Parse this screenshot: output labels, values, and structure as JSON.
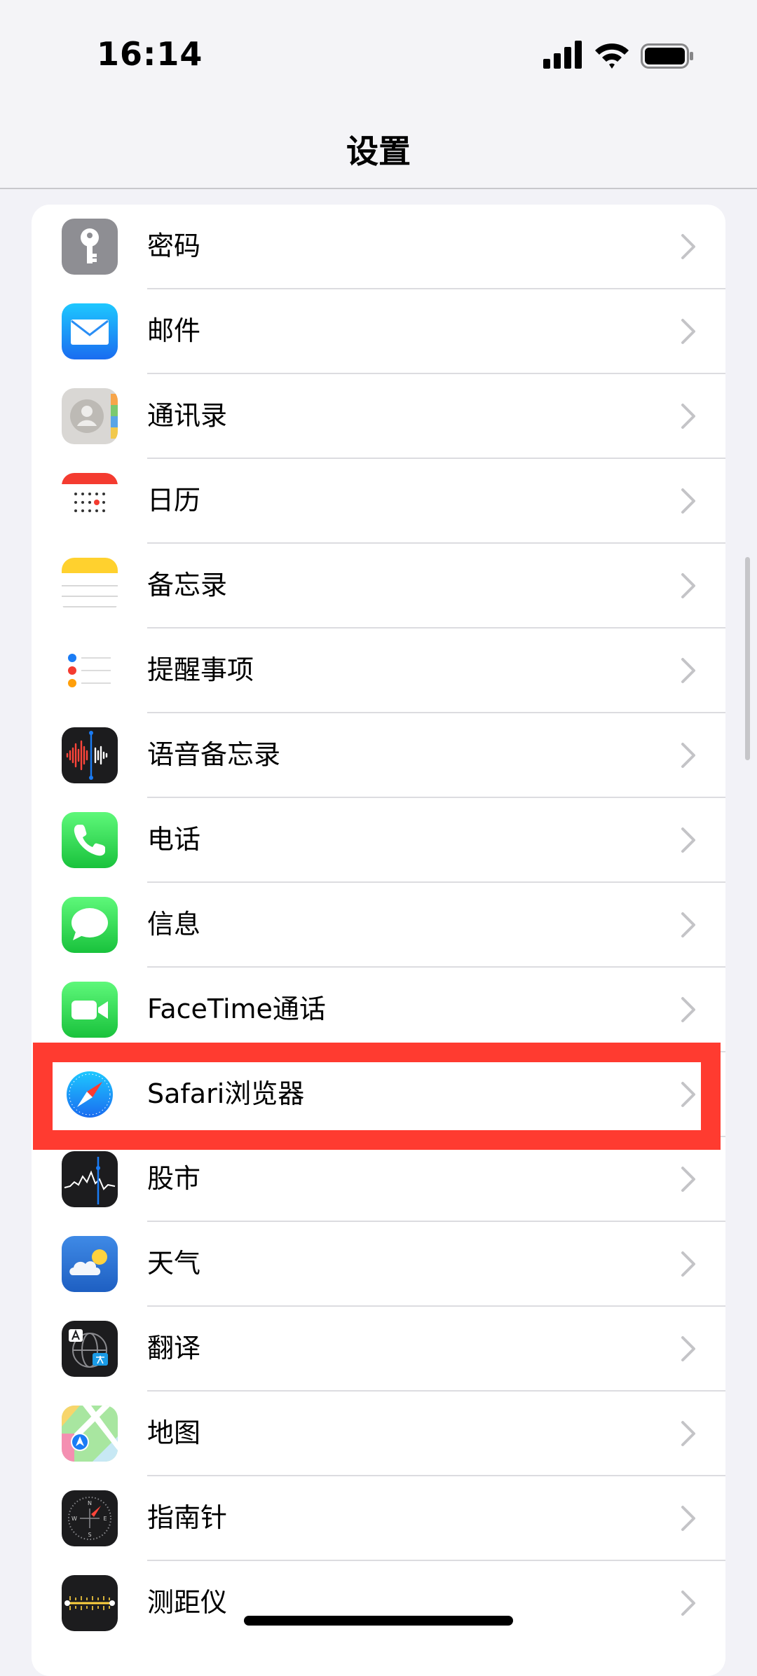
{
  "status_bar": {
    "time": "16:14"
  },
  "header": {
    "title": "设置"
  },
  "settings_items": [
    {
      "label": "密码",
      "icon": "key-icon"
    },
    {
      "label": "邮件",
      "icon": "mail-icon"
    },
    {
      "label": "通讯录",
      "icon": "contacts-icon"
    },
    {
      "label": "日历",
      "icon": "calendar-icon"
    },
    {
      "label": "备忘录",
      "icon": "notes-icon"
    },
    {
      "label": "提醒事项",
      "icon": "reminders-icon"
    },
    {
      "label": "语音备忘录",
      "icon": "voice-memos-icon"
    },
    {
      "label": "电话",
      "icon": "phone-icon"
    },
    {
      "label": "信息",
      "icon": "messages-icon"
    },
    {
      "label": "FaceTime通话",
      "icon": "facetime-icon"
    },
    {
      "label": "Safari浏览器",
      "icon": "safari-icon",
      "highlighted": true
    },
    {
      "label": "股市",
      "icon": "stocks-icon"
    },
    {
      "label": "天气",
      "icon": "weather-icon"
    },
    {
      "label": "翻译",
      "icon": "translate-icon"
    },
    {
      "label": "地图",
      "icon": "maps-icon"
    },
    {
      "label": "指南针",
      "icon": "compass-icon"
    },
    {
      "label": "测距仪",
      "icon": "measure-icon"
    }
  ],
  "colors": {
    "highlight": "#ff3b30",
    "background": "#f2f2f7"
  }
}
